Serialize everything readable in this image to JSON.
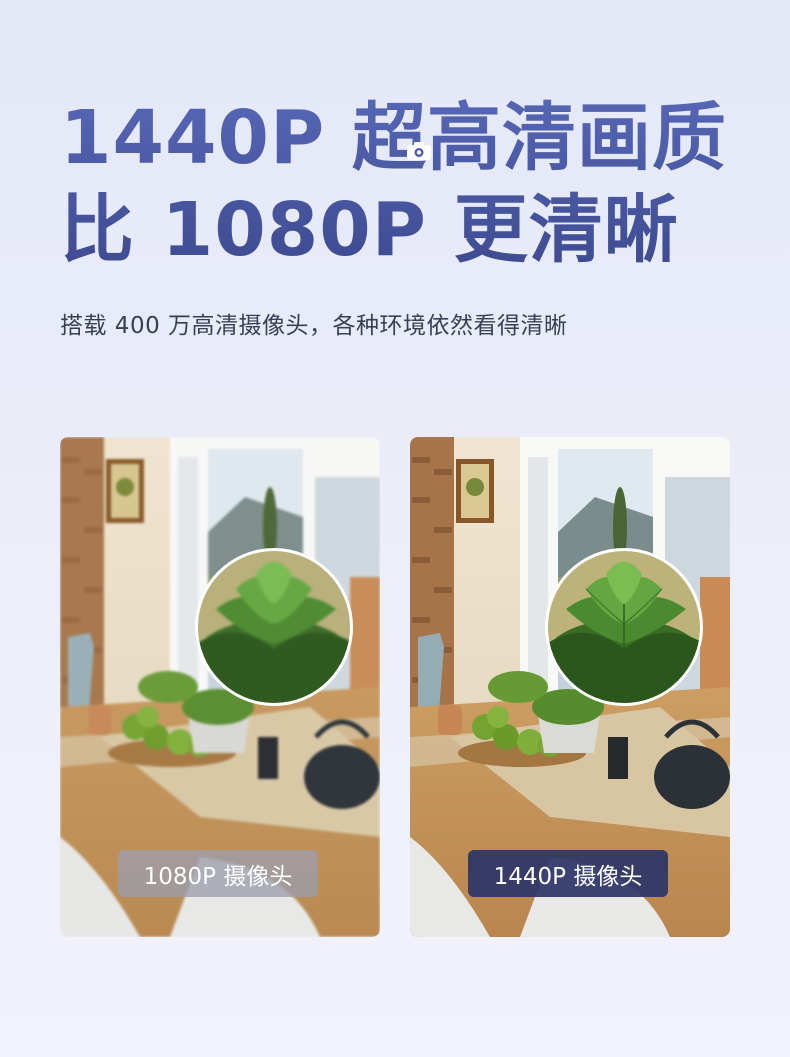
{
  "headline": {
    "line1": "1440P 超高清画质",
    "line2": "比 1080P 更清晰"
  },
  "subtitle": "搭载 400 万高清摄像头，各种环境依然看得清晰",
  "comparison": {
    "left_label": "1080P 摄像头",
    "right_label": "1440P 摄像头"
  },
  "colors": {
    "headline": "#4a5aa6",
    "left_badge": "#9b9eac",
    "right_badge": "#2c3468"
  },
  "icons": [
    "camera-icon"
  ]
}
